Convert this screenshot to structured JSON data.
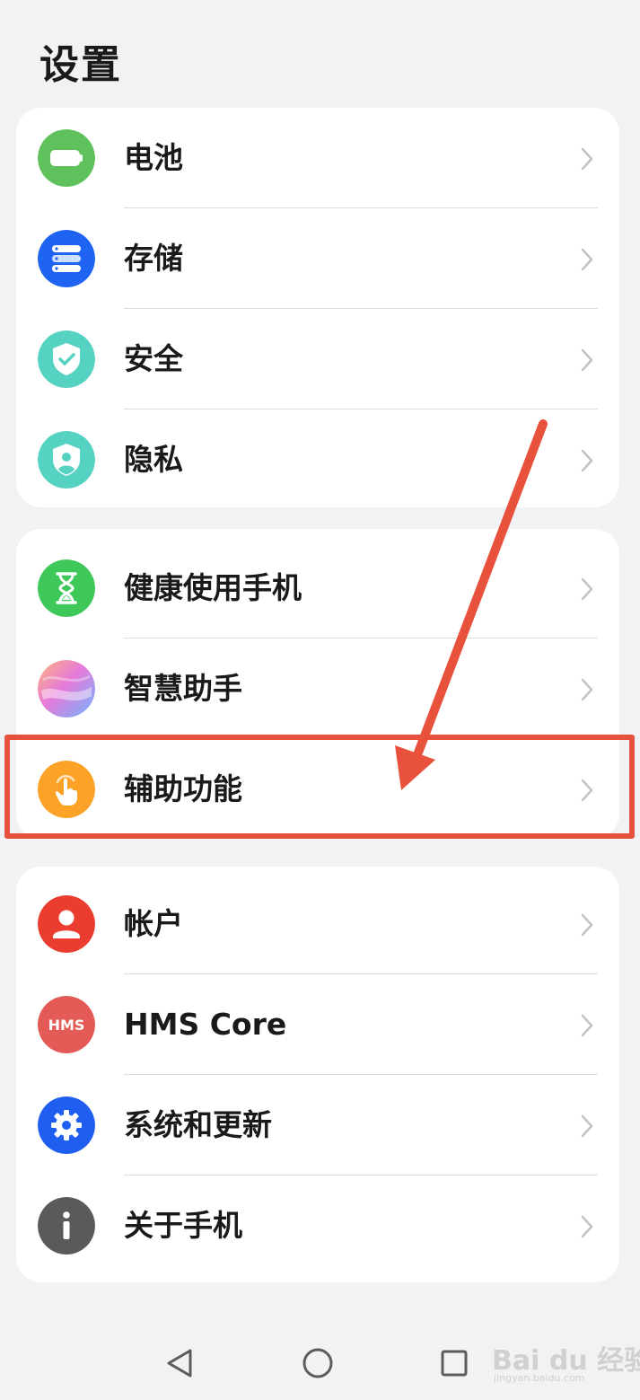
{
  "header": {
    "title": "设置"
  },
  "groups": [
    {
      "items": [
        {
          "label": "电池",
          "icon": "battery-icon",
          "color": "#5fc15b"
        },
        {
          "label": "存储",
          "icon": "storage-icon",
          "color": "#1f63f2"
        },
        {
          "label": "安全",
          "icon": "security-shield-icon",
          "color": "#56d2c2"
        },
        {
          "label": "隐私",
          "icon": "privacy-shield-icon",
          "color": "#56d2c2"
        }
      ]
    },
    {
      "items": [
        {
          "label": "健康使用手机",
          "icon": "hourglass-icon",
          "color": "#3fc85a"
        },
        {
          "label": "智慧助手",
          "icon": "smart-assistant-icon",
          "color": "#c38ff0"
        },
        {
          "label": "辅助功能",
          "icon": "accessibility-hand-icon",
          "color": "#fca227"
        }
      ]
    },
    {
      "items": [
        {
          "label": "帐户",
          "icon": "account-icon",
          "color": "#ea3d2f"
        },
        {
          "label": "HMS Core",
          "icon": "hms-core-icon",
          "color": "#e45a56",
          "icon_text": "HMS"
        },
        {
          "label": "系统和更新",
          "icon": "gear-icon",
          "color": "#1f5ef0"
        },
        {
          "label": "关于手机",
          "icon": "info-icon",
          "color": "#5a5a5a"
        }
      ]
    }
  ],
  "annotation": {
    "color": "#e8513c",
    "target": "辅助功能"
  },
  "watermark": {
    "main": "Bai du 经验",
    "sub": "jingyan.baidu.com"
  },
  "navbar": {
    "buttons": [
      "back-icon",
      "home-icon",
      "recents-icon"
    ]
  }
}
